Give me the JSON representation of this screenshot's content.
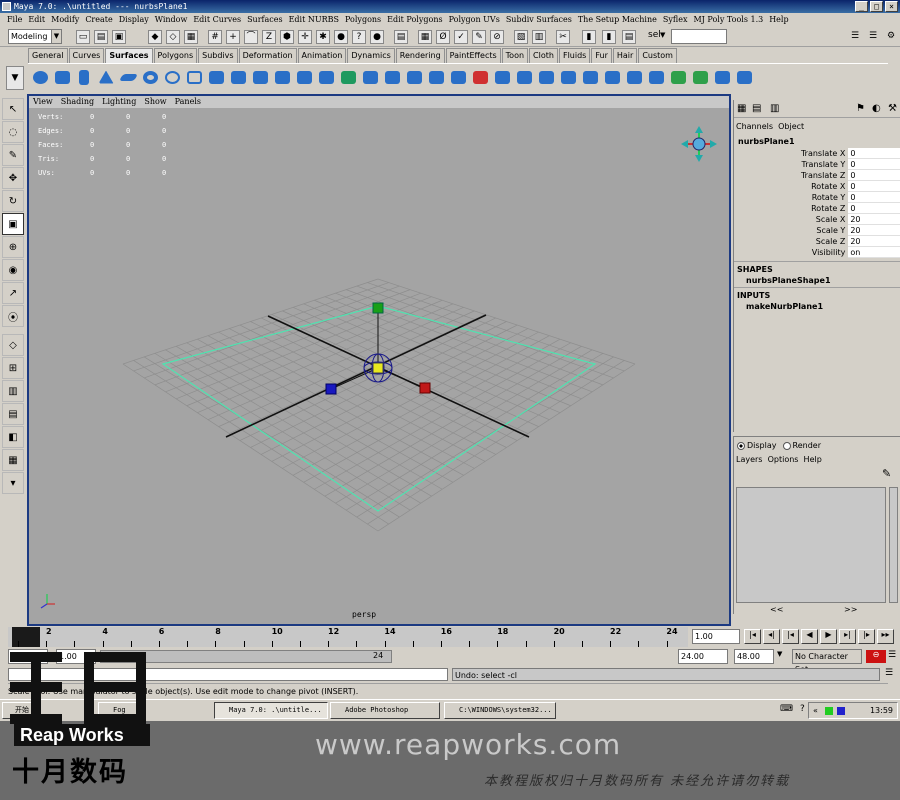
{
  "window": {
    "title": "Maya 7.0: .\\untitled   ---   nurbsPlane1"
  },
  "menubar": [
    "File",
    "Edit",
    "Modify",
    "Create",
    "Display",
    "Window",
    "Edit Curves",
    "Surfaces",
    "Edit NURBS",
    "Polygons",
    "Edit Polygons",
    "Polygon UVs",
    "Subdiv Surfaces",
    "The Setup Machine",
    "Syflex",
    "MJ Poly Tools 1.3",
    "Help"
  ],
  "statusline": {
    "mode": "Modeling",
    "sel_label": "sel",
    "sel_value": ""
  },
  "shelf": {
    "tabs": [
      "General",
      "Curves",
      "Surfaces",
      "Polygons",
      "Subdivs",
      "Deformation",
      "Animation",
      "Dynamics",
      "Rendering",
      "PaintEffects",
      "Toon",
      "Cloth",
      "Fluids",
      "Fur",
      "Hair",
      "Custom"
    ],
    "active_tab": "Surfaces"
  },
  "panel_menu": [
    "View",
    "Shading",
    "Lighting",
    "Show",
    "Panels"
  ],
  "hud": [
    {
      "label": "Verts:",
      "a": "0",
      "b": "0",
      "c": "0"
    },
    {
      "label": "Edges:",
      "a": "0",
      "b": "0",
      "c": "0"
    },
    {
      "label": "Faces:",
      "a": "0",
      "b": "0",
      "c": "0"
    },
    {
      "label": "Tris:",
      "a": "0",
      "b": "0",
      "c": "0"
    },
    {
      "label": "UVs:",
      "a": "0",
      "b": "0",
      "c": "0"
    }
  ],
  "viewport": {
    "camera": "persp",
    "bg": "#a4a4a4",
    "grid": "#8c8c8c",
    "plane_outline": "#4fe3b0"
  },
  "channel_box": {
    "menu": [
      "Channels",
      "Object"
    ],
    "object": "nurbsPlane1",
    "attrs": [
      {
        "name": "Translate X",
        "value": "0"
      },
      {
        "name": "Translate Y",
        "value": "0"
      },
      {
        "name": "Translate Z",
        "value": "0"
      },
      {
        "name": "Rotate X",
        "value": "0"
      },
      {
        "name": "Rotate Y",
        "value": "0"
      },
      {
        "name": "Rotate Z",
        "value": "0"
      },
      {
        "name": "Scale X",
        "value": "20"
      },
      {
        "name": "Scale Y",
        "value": "20"
      },
      {
        "name": "Scale Z",
        "value": "20"
      },
      {
        "name": "Visibility",
        "value": "on"
      }
    ],
    "shapes_label": "SHAPES",
    "shapes": [
      "nurbsPlaneShape1"
    ],
    "inputs_label": "INPUTS",
    "inputs": [
      "makeNurbPlane1"
    ]
  },
  "layer_editor": {
    "display": "Display",
    "render": "Render",
    "menu": [
      "Layers",
      "Options",
      "Help"
    ],
    "scroll": "<<"
  },
  "time": {
    "ticks": [
      "2",
      "4",
      "6",
      "8",
      "10",
      "12",
      "14",
      "16",
      "18",
      "20",
      "22",
      "24"
    ],
    "current": "1.00",
    "range_start": "1.00",
    "range_start2": "1.00",
    "range_marker": "24",
    "range_end": "24.00",
    "end": "48.00",
    "character_set": "No Character Set"
  },
  "command": {
    "result": "Undo: select -cl"
  },
  "helpline": "Scale Tool: Use manipulator to scale object(s). Use edit mode to change pivot (INSERT).",
  "taskbar": {
    "start": "开始",
    "items": [
      "Fog",
      "Maya 7.0: .\\untitle...",
      "Adobe Photoshop",
      "C:\\WINDOWS\\system32..."
    ],
    "clock": "13:59"
  },
  "watermark": {
    "url": "www.reapworks.com",
    "copyright": "本教程版权归十月数码所有 未经允许请勿转载",
    "brand_en": "Reap Works",
    "brand_cn": "十月数码"
  }
}
